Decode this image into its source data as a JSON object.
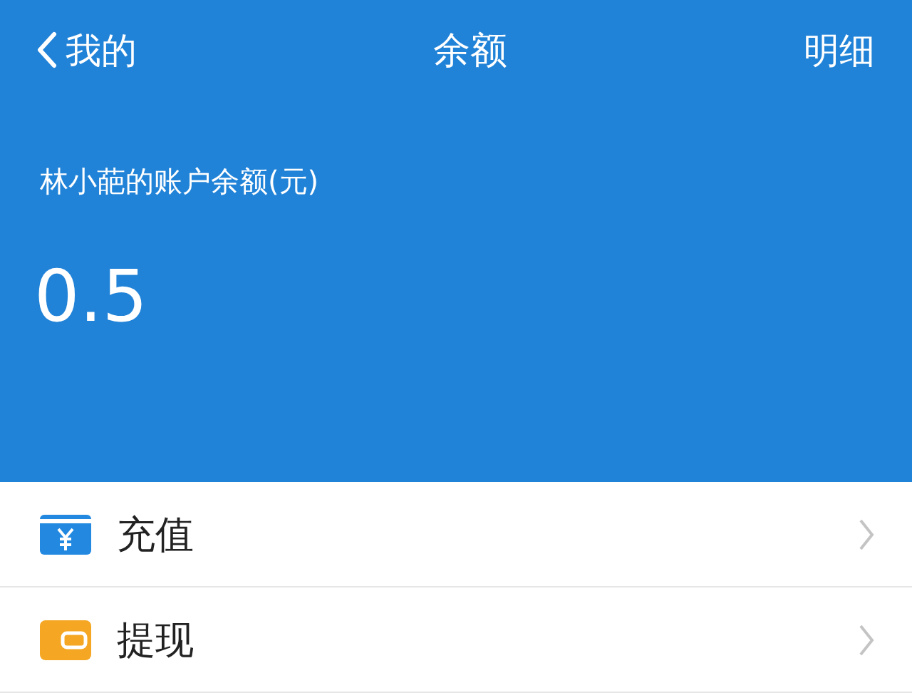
{
  "nav": {
    "back": "我的",
    "title": "余额",
    "action": "明细"
  },
  "balance": {
    "label": "林小葩的账户余额(元)",
    "amount": "0.5"
  },
  "menu": [
    {
      "kind": "recharge",
      "label": "充值"
    },
    {
      "kind": "withdraw",
      "label": "提现"
    }
  ]
}
